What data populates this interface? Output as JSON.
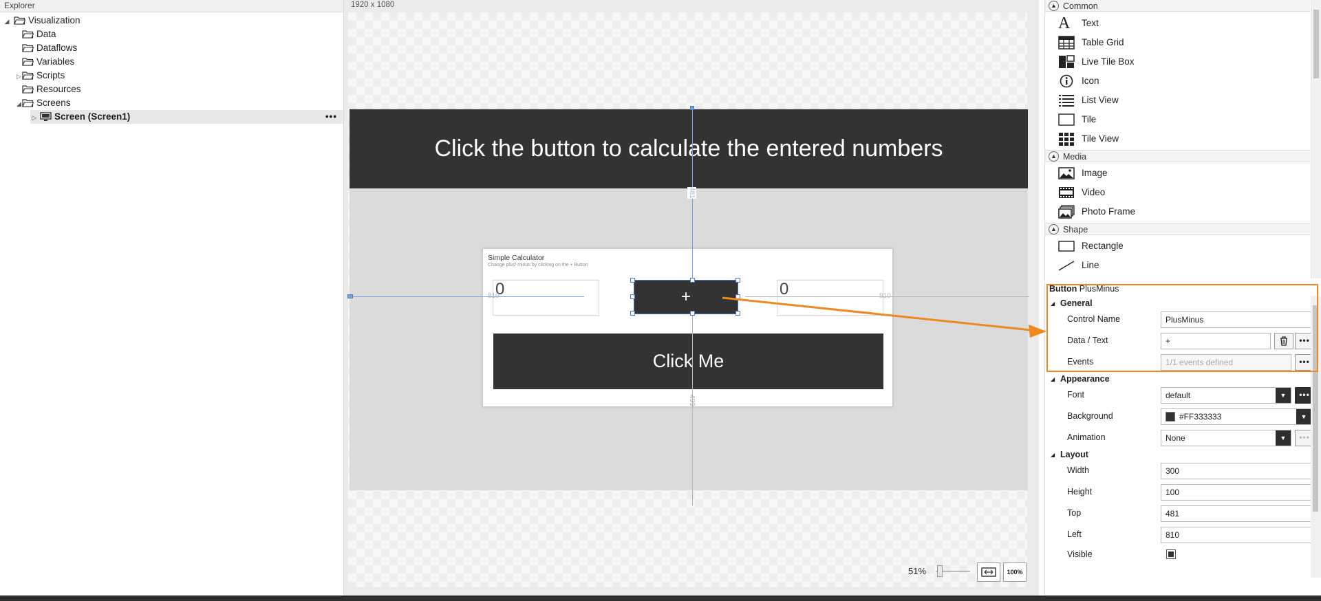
{
  "explorer": {
    "title": "Explorer",
    "tree": [
      {
        "label": "Visualization",
        "level": 0,
        "expanded": true
      },
      {
        "label": "Data",
        "level": 1
      },
      {
        "label": "Dataflows",
        "level": 1
      },
      {
        "label": "Variables",
        "level": 1
      },
      {
        "label": "Scripts",
        "level": 1,
        "collapsed": true
      },
      {
        "label": "Resources",
        "level": 1
      },
      {
        "label": "Screens",
        "level": 1,
        "expanded": true
      },
      {
        "label": "Screen (Screen1)",
        "level": 2,
        "selected": true
      }
    ],
    "more_label": "•••"
  },
  "canvas": {
    "dimensions": "1920 x 1080",
    "header_text": "Click the button to calculate the entered numbers",
    "calculator": {
      "title": "Simple Calculator",
      "subtitle": "Change plus/ minus by clicking on the + Button",
      "input_left_value": "0",
      "input_right_value": "0",
      "plus_label": "+",
      "click_label": "Click Me"
    },
    "guides": {
      "top": "481",
      "left": "810",
      "right": "810",
      "bottom": "499"
    },
    "zoom": {
      "level": "51%",
      "fit_label": "[ ]",
      "full_label": "100%"
    }
  },
  "toolbox": {
    "categories": [
      {
        "name": "Common",
        "items": [
          {
            "label": "Text",
            "icon": "text-icon"
          },
          {
            "label": "Table Grid",
            "icon": "table-grid-icon"
          },
          {
            "label": "Live Tile Box",
            "icon": "live-tile-box-icon"
          },
          {
            "label": "Icon",
            "icon": "info-icon"
          },
          {
            "label": "List View",
            "icon": "list-view-icon"
          },
          {
            "label": "Tile",
            "icon": "tile-icon"
          },
          {
            "label": "Tile View",
            "icon": "tile-view-icon"
          }
        ]
      },
      {
        "name": "Media",
        "items": [
          {
            "label": "Image",
            "icon": "image-icon"
          },
          {
            "label": "Video",
            "icon": "video-icon"
          },
          {
            "label": "Photo Frame",
            "icon": "photo-frame-icon"
          }
        ]
      },
      {
        "name": "Shape",
        "items": [
          {
            "label": "Rectangle",
            "icon": "rectangle-icon"
          },
          {
            "label": "Line",
            "icon": "line-icon"
          }
        ]
      }
    ]
  },
  "properties": {
    "type": "Button",
    "name": "PlusMinus",
    "sections": {
      "general": "General",
      "appearance": "Appearance",
      "layout": "Layout"
    },
    "control_name": {
      "label": "Control Name",
      "value": "PlusMinus"
    },
    "data_text": {
      "label": "Data / Text",
      "value": "+"
    },
    "events": {
      "label": "Events",
      "value": "1/1 events defined"
    },
    "font": {
      "label": "Font",
      "value": "default"
    },
    "background": {
      "label": "Background",
      "value": "#FF333333"
    },
    "animation": {
      "label": "Animation",
      "value": "None"
    },
    "width": {
      "label": "Width",
      "value": "300"
    },
    "height": {
      "label": "Height",
      "value": "100"
    },
    "top": {
      "label": "Top",
      "value": "481"
    },
    "left": {
      "label": "Left",
      "value": "810"
    },
    "visible": {
      "label": "Visible",
      "value": true
    }
  },
  "colors": {
    "accent_orange": "#f0871f",
    "dark": "#333333",
    "selection_blue": "#4a78c2"
  }
}
